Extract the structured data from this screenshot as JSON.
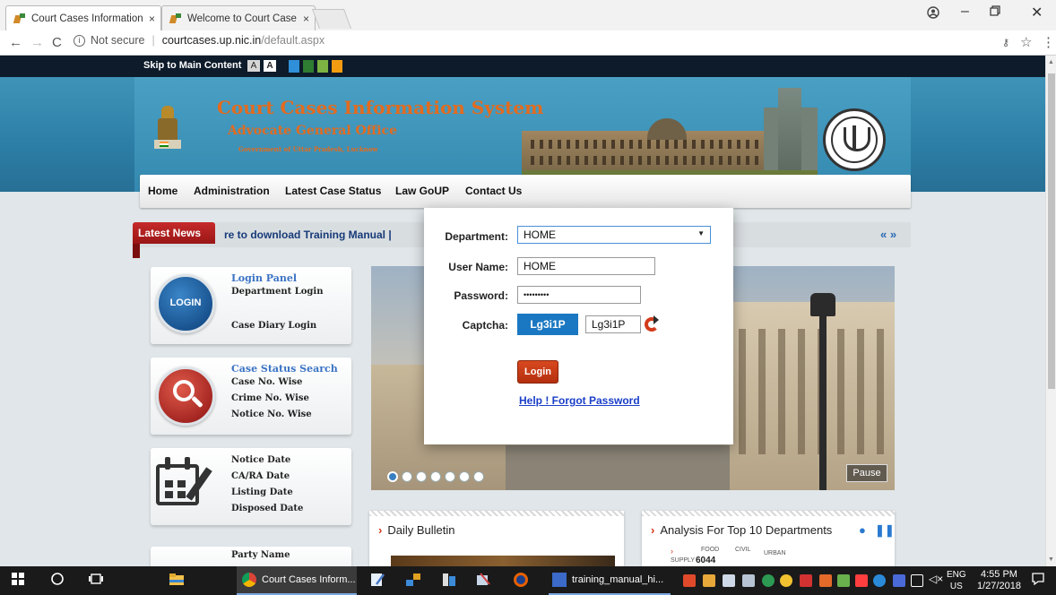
{
  "browser": {
    "tabs": [
      {
        "label": "Court Cases Information",
        "close": "×"
      },
      {
        "label": "Welcome to Court Case",
        "close": "×"
      }
    ],
    "url_security": "Not secure",
    "url_domain": "courtcases.up.nic.in",
    "url_path": "/default.aspx"
  },
  "topbar": {
    "skip_link": "Skip to Main Content",
    "font_small": "A",
    "font_large": "A",
    "theme_colors": [
      "#2f8fd8",
      "#2e7d32",
      "#7cb342",
      "#f39c12"
    ]
  },
  "header": {
    "title": "Court Cases Information System",
    "subtitle": "Advocate General Office",
    "org": "Government of Uttar Pradesh, Lucknow",
    "accent_color": "#e36b1f"
  },
  "nav": {
    "items": [
      "Home",
      "Administration",
      "Latest Case Status",
      "Law GoUP",
      "Contact Us"
    ]
  },
  "news": {
    "tag": "Latest News",
    "ticker": "re to download Training Manual  |",
    "arrows": "« »"
  },
  "cards": {
    "login": {
      "icon_text": "LOGIN",
      "title": "Login Panel",
      "items": [
        "Department Login",
        "Case Diary Login"
      ]
    },
    "status": {
      "title": "Case Status Search",
      "items": [
        "Case No. Wise",
        "Crime No. Wise",
        "Notice No. Wise"
      ]
    },
    "dates": {
      "items": [
        "Notice Date",
        "CA/RA Date",
        "Listing Date",
        "Disposed Date"
      ]
    },
    "party": {
      "items": [
        "Party Name"
      ]
    }
  },
  "slider": {
    "pause_label": "Pause",
    "dot_count": 7,
    "active_dot": 0
  },
  "panels": {
    "bulletin": "Daily Bulletin",
    "analysis": "Analysis For Top 10 Departments",
    "stats": [
      "FOOD",
      "CIVIL",
      "URBAN",
      "SUPPLY",
      "6044"
    ]
  },
  "login_form": {
    "department_label": "Department:",
    "department_value": "HOME",
    "username_label": "User Name:",
    "username_value": "HOME",
    "password_label": "Password:",
    "password_value": "•••••••••",
    "captcha_label": "Captcha:",
    "captcha_code": "Lg3i1P",
    "captcha_input": "Lg3i1P",
    "login_button": "Login",
    "help_link": "Help ! Forgot Password"
  },
  "taskbar": {
    "items": [
      "Court Cases Inform...",
      "training_manual_hi..."
    ],
    "lang_top": "ENG",
    "lang_bottom": "US",
    "time": "4:55 PM",
    "date": "1/27/2018"
  }
}
